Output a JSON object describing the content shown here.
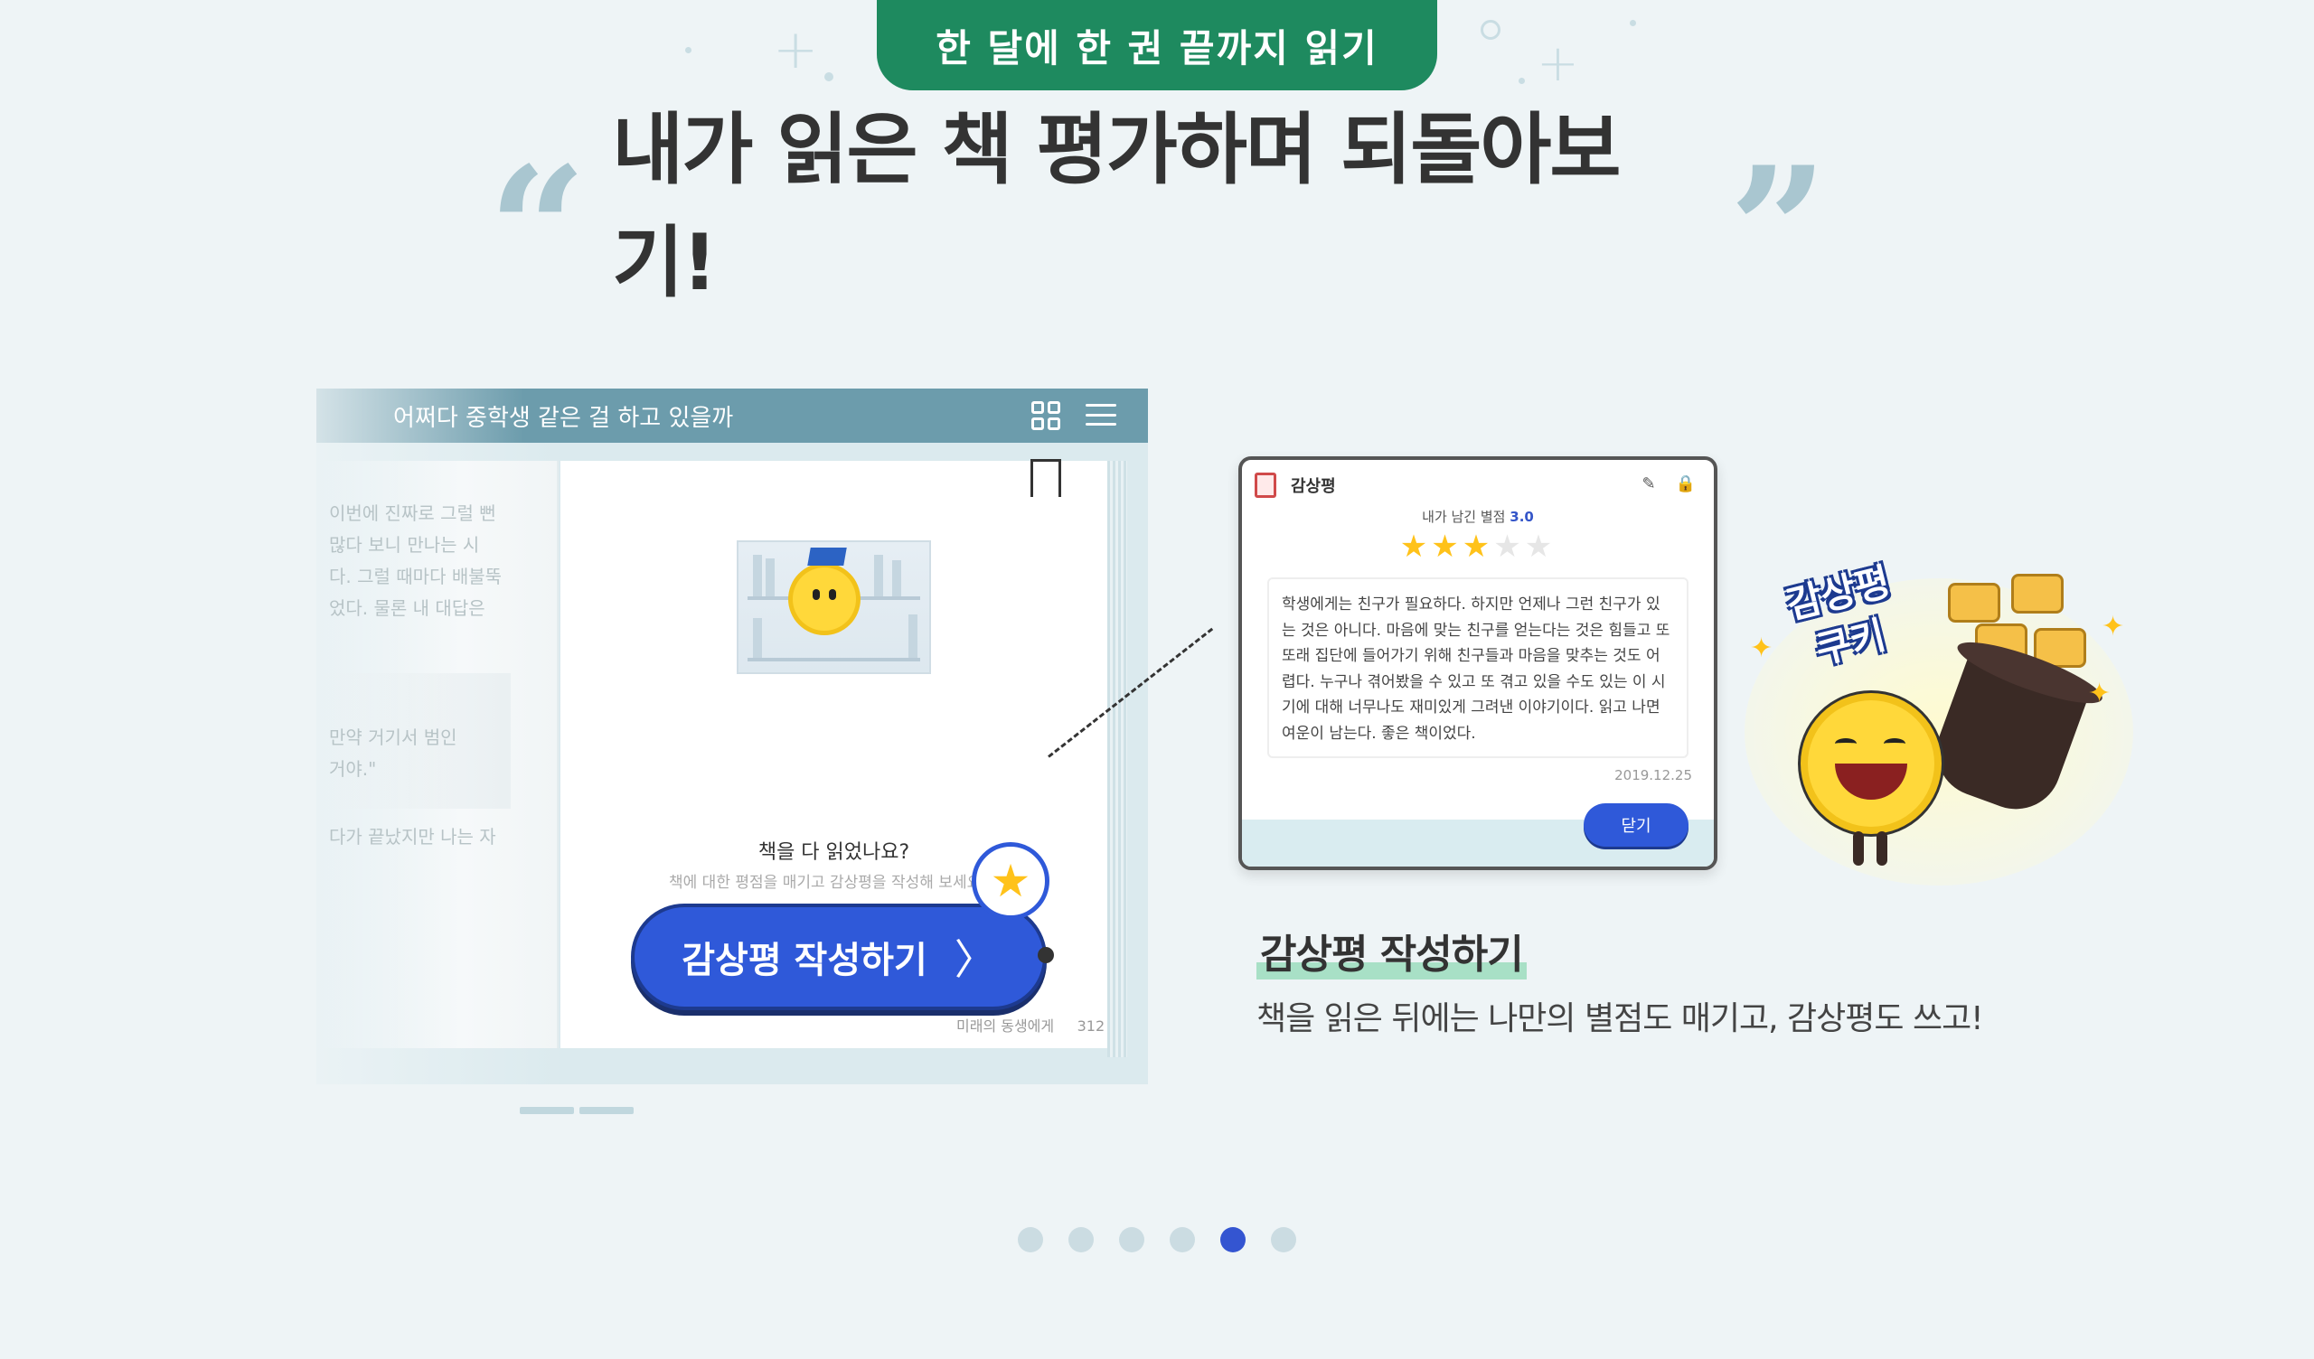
{
  "top_tab": {
    "label": "한 달에 한 권 끝까지 읽기"
  },
  "headline": {
    "open_quote": "“",
    "text": "내가 읽은 책 평가하며 되돌아보기!",
    "close_quote": "”"
  },
  "reader": {
    "book_title": "어쩌다 중학생 같은 걸 하고 있을까",
    "left_page_lines": [
      "이번에 진짜로 그럴 뻔",
      "많다 보니 만나는 시",
      "다. 그럴 때마다 배불뚝",
      "었다. 물론 내 대답은"
    ],
    "left_page_box_lines": [
      "만약 거기서 범인",
      "거야.\""
    ],
    "left_page_tail": "다가 끝났지만 나는 자",
    "done_question": "책을 다 읽었나요?",
    "done_sub": "책에 대한 평점을 매기고 감상평을 작성해 보세요.",
    "write_button": "감상평 작성하기",
    "chevron": "〉",
    "star_badge": "★",
    "footer_title": "미래의 동생에게",
    "footer_page": "312"
  },
  "review_card": {
    "title": "감상평",
    "edit_icon": "✎",
    "lock_icon": "🔒",
    "rating_label": "내가 남긴 별점",
    "rating_value": "3.0",
    "rating": 3,
    "rating_max": 5,
    "star_glyph": "★",
    "body": "학생에게는 친구가 필요하다. 하지만 언제나 그런 친구가 있는 것은 아니다. 마음에 맞는 친구를 얻는다는 것은 힘들고 또 또래 집단에 들어가기 위해 친구들과 마음을 맞추는 것도 어렵다. 누구나 겪어봤을 수 있고 또 겪고 있을 수도 있는 이 시기에 대해 너무나도 재미있게 그려낸 이야기이다. 읽고 나면 여운이 남는다. 좋은 책이었다.",
    "date": "2019.12.25",
    "close_button": "닫기"
  },
  "cookie_badge": {
    "line1": "감상평",
    "line2": "쿠키"
  },
  "feature": {
    "title": "감상평 작성하기",
    "description": "책을 읽은 뒤에는 나만의 별점도 매기고, 감상평도 쓰고!"
  },
  "pager": {
    "count": 6,
    "active_index": 4
  },
  "colors": {
    "background": "#eef4f6",
    "tab_green": "#1e8a5f",
    "primary_blue": "#2f59d9",
    "reader_bar": "#6c9cac",
    "star_yellow": "#ffc21a",
    "highlight_mint": "#a8e0c6"
  },
  "icons": [
    "grid-view-icon",
    "list-menu-icon",
    "bookmark-icon",
    "document-icon",
    "edit-icon",
    "lock-icon",
    "star-icon",
    "chevron-right-icon"
  ]
}
